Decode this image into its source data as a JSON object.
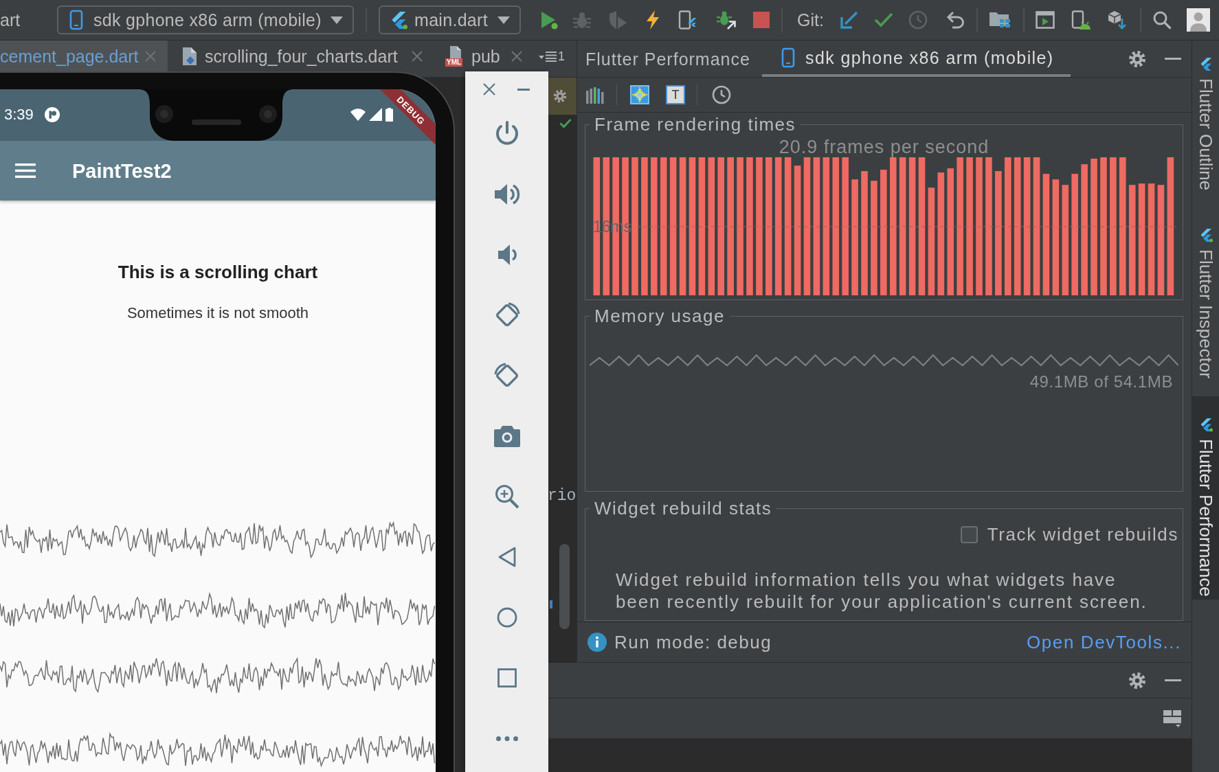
{
  "toolbar": {
    "project_name": "art",
    "device_selector": "sdk gphone x86 arm (mobile)",
    "run_configuration": "main.dart",
    "git_label": "Git:"
  },
  "editor_tabs": [
    {
      "label": "cement_page.dart",
      "kind": "plain",
      "selected": true,
      "modified": true
    },
    {
      "label": "scrolling_four_charts.dart",
      "kind": "dart",
      "selected": false,
      "modified": false
    },
    {
      "label": "pub",
      "kind": "yaml",
      "badge": "YML",
      "selected": false,
      "modified": false
    }
  ],
  "tab_list_count": "1",
  "editor": {
    "code_fragment": "rio"
  },
  "emulator": {
    "status_time": "3:39",
    "debug_banner": "DEBUG",
    "app_title": "PaintTest2",
    "heading": "This is a scrolling chart",
    "subheading": "Sometimes it is not smooth"
  },
  "performance_panel": {
    "title": "Flutter Performance",
    "tabs": [
      {
        "label": "sdk gphone x86 arm (mobile)",
        "selected": true
      }
    ],
    "toolbar_text_toggle": "T",
    "frame_rendering": {
      "title": "Frame rendering times",
      "fps": "20.9 frames per second",
      "threshold_label": "16ms"
    },
    "memory_usage": {
      "title": "Memory usage",
      "reading": "49.1MB of 54.1MB"
    },
    "widget_rebuild": {
      "title": "Widget rebuild stats",
      "track_rebuilds": {
        "label": "Track widget rebuilds",
        "checked": false
      },
      "info": "Widget rebuild information tells you what widgets have been recently rebuilt for your application's current screen."
    },
    "run_mode": "Run mode: debug",
    "devtools_link": "Open DevTools..."
  },
  "side_tabs": [
    {
      "label": "Flutter Outline",
      "selected": false,
      "active": false
    },
    {
      "label": "Flutter Inspector",
      "selected": false,
      "active": true
    },
    {
      "label": "Flutter Performance",
      "selected": true,
      "active": true
    }
  ]
}
